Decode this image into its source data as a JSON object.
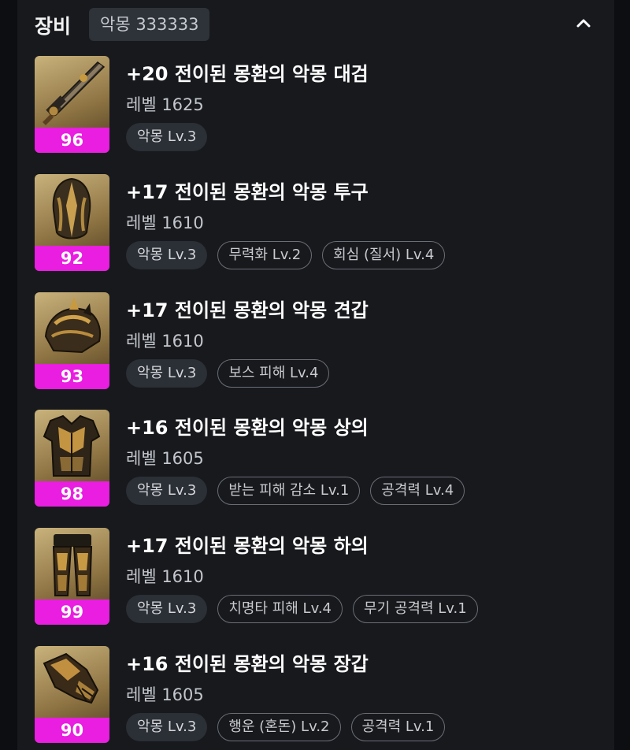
{
  "header": {
    "title": "장비",
    "badge": "악몽 333333",
    "collapse_icon": "chevron-up-icon"
  },
  "items": [
    {
      "name": "+20 전이된 몽환의 악몽 대검",
      "level": "레벨 1625",
      "quality": "96",
      "icon": "greatsword-icon",
      "tags": [
        {
          "label": "악몽 Lv.3",
          "style": "primary"
        }
      ]
    },
    {
      "name": "+17 전이된 몽환의 악몽 투구",
      "level": "레벨 1610",
      "quality": "92",
      "icon": "helmet-icon",
      "tags": [
        {
          "label": "악몽 Lv.3",
          "style": "primary"
        },
        {
          "label": "무력화 Lv.2",
          "style": "outline"
        },
        {
          "label": "회심 (질서) Lv.4",
          "style": "outline"
        }
      ]
    },
    {
      "name": "+17 전이된 몽환의 악몽 견갑",
      "level": "레벨 1610",
      "quality": "93",
      "icon": "pauldron-icon",
      "tags": [
        {
          "label": "악몽 Lv.3",
          "style": "primary"
        },
        {
          "label": "보스 피해 Lv.4",
          "style": "outline"
        }
      ]
    },
    {
      "name": "+16 전이된 몽환의 악몽 상의",
      "level": "레벨 1605",
      "quality": "98",
      "icon": "chest-armor-icon",
      "tags": [
        {
          "label": "악몽 Lv.3",
          "style": "primary"
        },
        {
          "label": "받는 피해 감소 Lv.1",
          "style": "outline"
        },
        {
          "label": "공격력 Lv.4",
          "style": "outline"
        }
      ]
    },
    {
      "name": "+17 전이된 몽환의 악몽 하의",
      "level": "레벨 1610",
      "quality": "99",
      "icon": "leg-armor-icon",
      "tags": [
        {
          "label": "악몽 Lv.3",
          "style": "primary"
        },
        {
          "label": "치명타 피해 Lv.4",
          "style": "outline"
        },
        {
          "label": "무기 공격력 Lv.1",
          "style": "outline"
        }
      ]
    },
    {
      "name": "+16 전이된 몽환의 악몽 장갑",
      "level": "레벨 1605",
      "quality": "90",
      "icon": "gauntlet-icon",
      "tags": [
        {
          "label": "악몽 Lv.3",
          "style": "primary"
        },
        {
          "label": "행운 (혼돈) Lv.2",
          "style": "outline"
        },
        {
          "label": "공격력 Lv.1",
          "style": "outline"
        }
      ]
    }
  ],
  "colors": {
    "quality_badge": "#e91ee0",
    "panel_bg": "#17191d"
  }
}
